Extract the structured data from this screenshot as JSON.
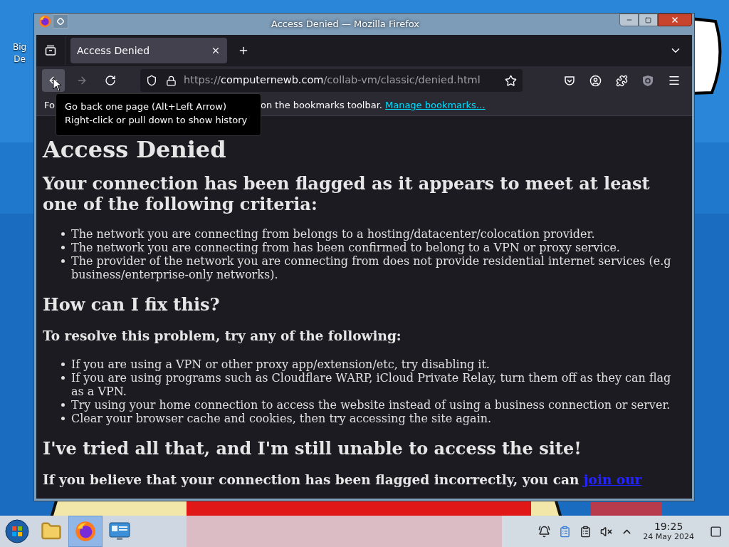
{
  "desktop": {
    "icon_label_lines": [
      "Big",
      "De"
    ]
  },
  "window": {
    "title": "Access Denied — Mozilla Firefox"
  },
  "tabs": [
    {
      "label": "Access Denied",
      "selected": true
    }
  ],
  "nav": {
    "forward_disabled": true
  },
  "address_bar": {
    "scheme": "https://",
    "host": "computernewb.com",
    "path": "/collab-vm/classic/denied.html"
  },
  "bookmarks_bar": {
    "text_start": "Fo",
    "text_end": "on the bookmarks toolbar.",
    "link": "Manage bookmarks…"
  },
  "tooltip": {
    "lines": [
      "Go back one page (Alt+Left Arrow)",
      "Right-click or pull down to show history"
    ]
  },
  "page": {
    "blocks": [
      {
        "kind": "h1",
        "text": "Access Denied"
      },
      {
        "kind": "h2",
        "text": "Your connection has been flagged as it appears to meet at least one of the following criteria:"
      },
      {
        "kind": "list",
        "items": [
          "The network you are connecting from belongs to a hosting/datacenter/colocation provider.",
          "The network you are connecting from has been confirmed to belong to a VPN or proxy service.",
          "The provider of the network you are connecting from does not provide residential internet services (e.g business/enterprise-only networks)."
        ]
      },
      {
        "kind": "h2",
        "text": "How can I fix this?"
      },
      {
        "kind": "h3",
        "text": "To resolve this problem, try any of the following:"
      },
      {
        "kind": "list",
        "items": [
          "If you are using a VPN or other proxy app/extension/etc, try disabling it.",
          "If you are using programs such as Cloudflare WARP, iCloud Private Relay, turn them off as they can flag as a VPN.",
          "Try using your home connection to access the website instead of using a business connection or server.",
          "Clear your browser cache and cookies, then try accessing the site again."
        ]
      },
      {
        "kind": "h2",
        "text": "I've tried all that, and I'm still unable to access the site!"
      },
      {
        "kind": "h3",
        "text": "If you believe that your connection has been flagged incorrectly, you can ",
        "link": "join our"
      }
    ]
  },
  "taskbar": {
    "apps": [
      {
        "kind": "start",
        "selected": false
      },
      {
        "kind": "folder",
        "selected": false
      },
      {
        "kind": "firefox",
        "selected": true
      },
      {
        "kind": "monitor",
        "selected": false
      }
    ],
    "clock": {
      "time": "19:25",
      "date": "24 May 2024"
    }
  }
}
